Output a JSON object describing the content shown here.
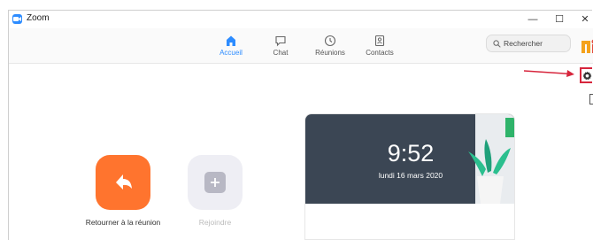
{
  "window": {
    "title": "Zoom",
    "controls": {
      "minimize": "—",
      "maximize": "☐",
      "close": "✕"
    }
  },
  "nav": {
    "tabs": [
      {
        "label": "Accueil",
        "icon": "home-icon",
        "active": true
      },
      {
        "label": "Chat",
        "icon": "chat-bubble-icon",
        "active": false
      },
      {
        "label": "Réunions",
        "icon": "clock-icon",
        "active": false
      },
      {
        "label": "Contacts",
        "icon": "contact-card-icon",
        "active": false
      }
    ],
    "search": {
      "placeholder": "Rechercher"
    }
  },
  "home": {
    "actions": [
      {
        "label": "Retourner à la réunion",
        "icon": "return-arrow-icon",
        "enabled": true
      },
      {
        "label": "Rejoindre",
        "icon": "plus-icon",
        "enabled": false
      }
    ],
    "clock": {
      "time": "9:52",
      "date": "lundi 16 mars 2020"
    }
  },
  "colors": {
    "accent": "#2d8cff",
    "orange": "#ff742e",
    "card_bg": "#3b4654",
    "annotation": "#d7263d"
  }
}
